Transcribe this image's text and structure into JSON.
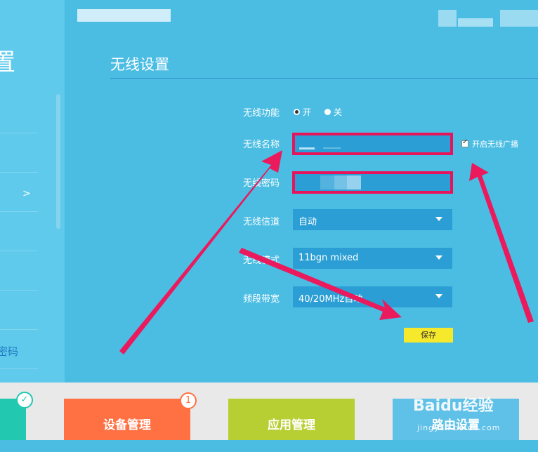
{
  "sidebar": {
    "title": "置",
    "chevron": ">",
    "fragments": [
      "："
    ],
    "password_link": "密码"
  },
  "header": {
    "page_title": "无线设置"
  },
  "form": {
    "wireless_function": {
      "label": "无线功能",
      "options": [
        {
          "label": "开",
          "selected": true
        },
        {
          "label": "关",
          "selected": false
        }
      ]
    },
    "ssid": {
      "label": "无线名称",
      "value": ""
    },
    "broadcast": {
      "label": "开启无线广播",
      "checked": true
    },
    "password": {
      "label": "无线密码",
      "value": ""
    },
    "channel": {
      "label": "无线信道",
      "value": "自动"
    },
    "mode": {
      "label": "无线模式",
      "value": "11bgn mixed"
    },
    "bandwidth": {
      "label": "频段带宽",
      "value": "40/20MHz自动"
    },
    "save_label": "保存"
  },
  "bottom_nav": {
    "tiles": [
      {
        "label": "",
        "color": "#22c8b0"
      },
      {
        "label": "设备管理",
        "color": "#ff7043",
        "badge": "1"
      },
      {
        "label": "应用管理",
        "color": "#b7cf33"
      },
      {
        "label": "路由设置",
        "color": "#60c1e8"
      }
    ],
    "watermark": "Baidu经验",
    "watermark_sub": "jingyan.baidu.com"
  },
  "colors": {
    "highlight": "#e8145b",
    "accent": "#2b9fd5",
    "save": "#f6e92b"
  }
}
